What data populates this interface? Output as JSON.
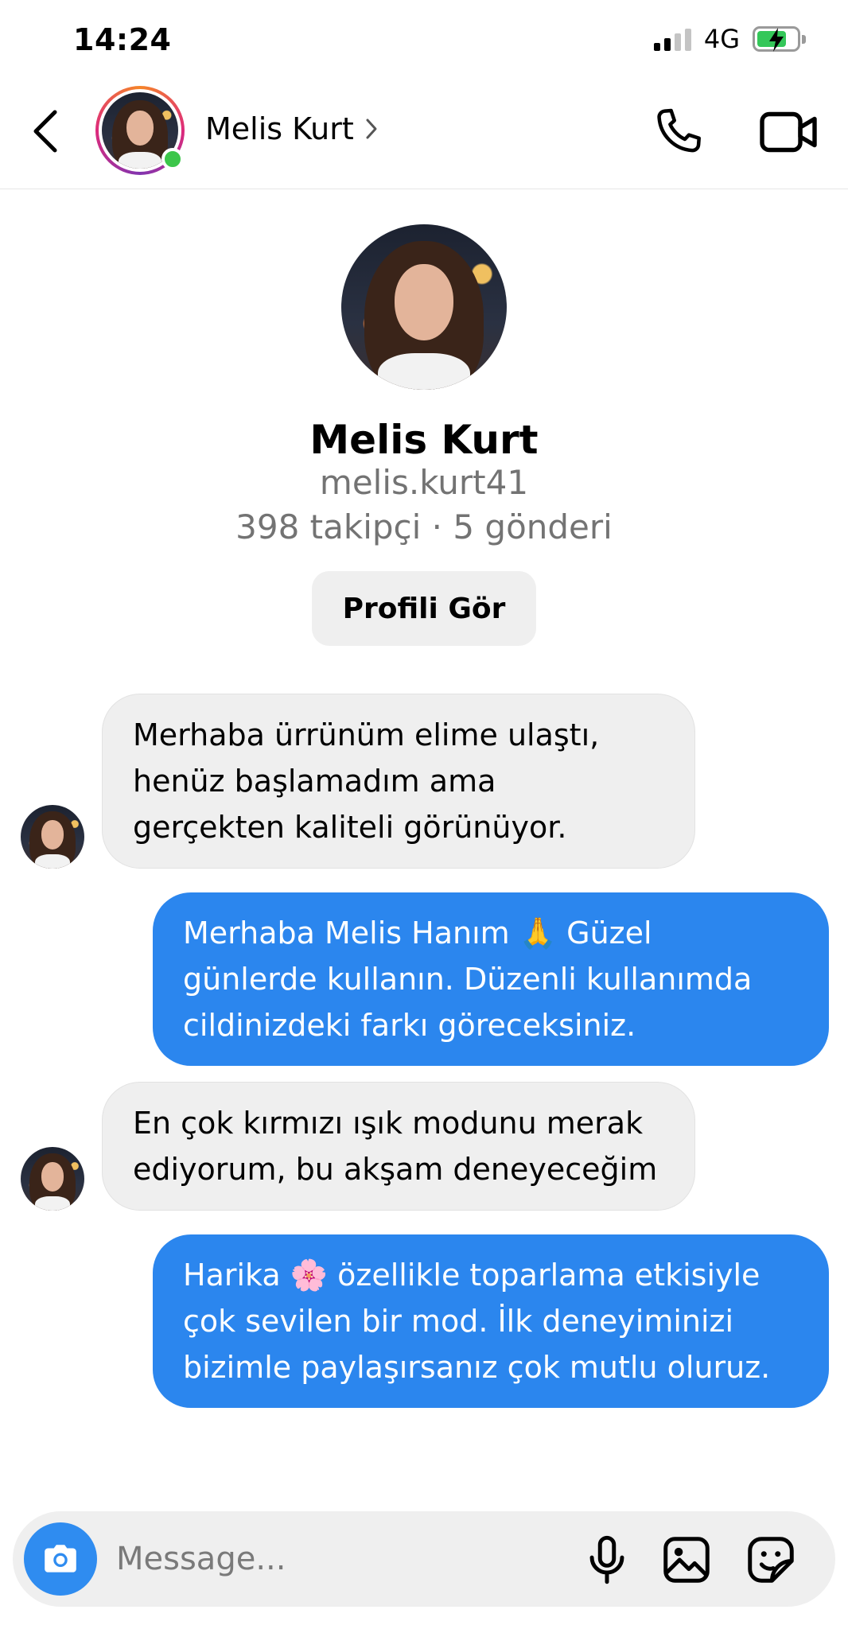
{
  "status_bar": {
    "time": "14:24",
    "network": "4G"
  },
  "header": {
    "contact_name": "Melis Kurt",
    "online": true
  },
  "profile": {
    "name": "Melis Kurt",
    "username": "melis.kurt41",
    "stats": "398 takipçi · 5 gönderi",
    "view_profile_label": "Profili Gör"
  },
  "messages": [
    {
      "direction": "incoming",
      "lines": [
        "Merhaba ürrünüm elime ulaştı,",
        "henüz başlamadım ama",
        "gerçekten kaliteli görünüyor."
      ]
    },
    {
      "direction": "outgoing",
      "lines": [
        "Merhaba Melis Hanım 🙏 Güzel",
        "günlerde kullanın. Düzenli kullanımda",
        "cildinizdeki farkı göreceksiniz."
      ]
    },
    {
      "direction": "incoming",
      "lines": [
        "En çok kırmızı ışık modunu merak",
        "ediyorum, bu akşam deneyeceğim"
      ]
    },
    {
      "direction": "outgoing",
      "lines": [
        "Harika 🌸 özellikle toparlama etkisiyle",
        "çok sevilen bir mod. İlk deneyiminizi",
        "bizimle paylaşırsanız çok mutlu oluruz."
      ]
    }
  ],
  "composer": {
    "placeholder": "Message..."
  },
  "colors": {
    "outgoing_bubble": "#2b86ee",
    "incoming_bubble": "#efefef",
    "online_dot": "#3cc64a",
    "camera_button": "#2f8cf0"
  },
  "icons": {
    "back": "chevron-left-icon",
    "phone": "phone-icon",
    "video": "video-camera-icon",
    "camera": "camera-icon",
    "mic": "microphone-icon",
    "gallery": "image-icon",
    "sticker": "sticker-icon"
  }
}
